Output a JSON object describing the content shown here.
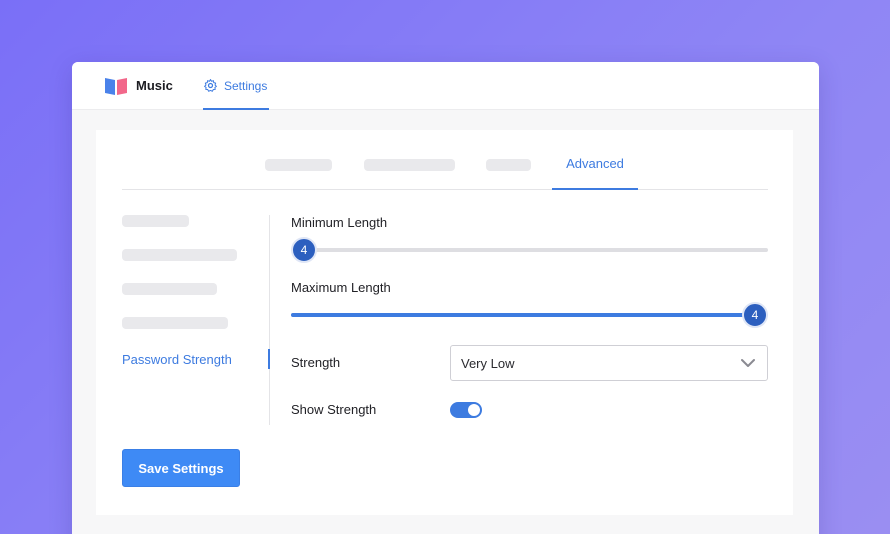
{
  "header": {
    "app_name": "Music",
    "nav_settings_label": "Settings"
  },
  "tabs": {
    "active_label": "Advanced"
  },
  "sidebar": {
    "active_label": "Password Strength"
  },
  "form": {
    "min_length": {
      "label": "Minimum Length",
      "value": "4",
      "fill_fraction": 0
    },
    "max_length": {
      "label": "Maximum Length",
      "value": "4",
      "fill_fraction": 1
    },
    "strength": {
      "label": "Strength",
      "selected": "Very Low"
    },
    "show_strength": {
      "label": "Show Strength",
      "on": true
    }
  },
  "actions": {
    "save_label": "Save Settings"
  },
  "colors": {
    "accent": "#3d7be0",
    "knob": "#2c5fbf",
    "button": "#3e8af5",
    "background_gradient_start": "#7a6ff7"
  },
  "icons": {
    "logo": "book-icon",
    "settings": "gear-icon",
    "dropdown": "chevron-down-icon"
  }
}
